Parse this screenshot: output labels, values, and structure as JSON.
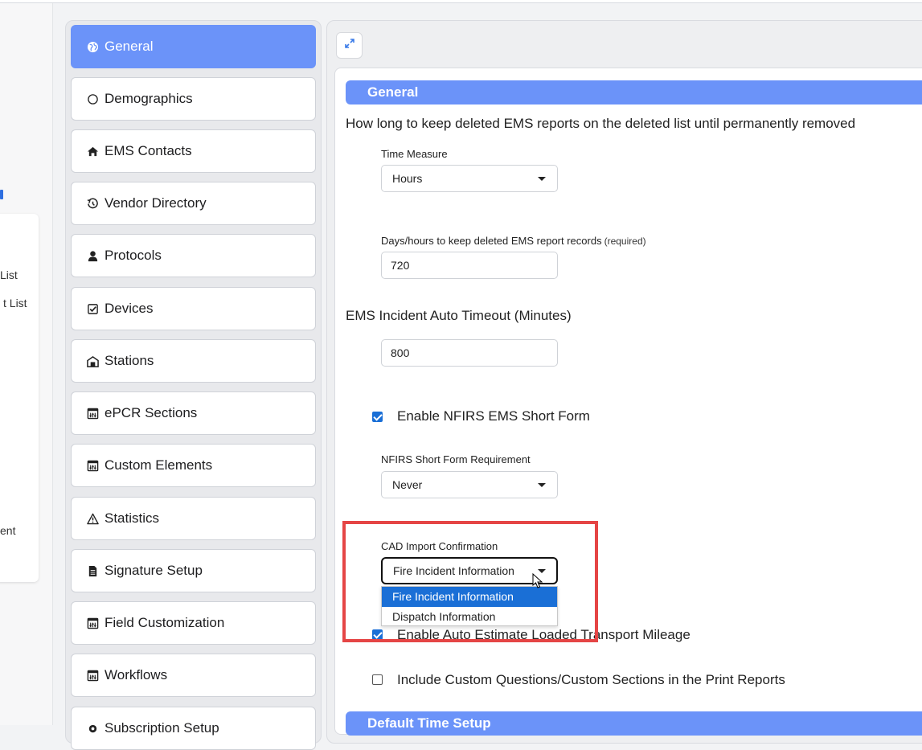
{
  "left_partial": {
    "items": [
      "List",
      "t List",
      "ent"
    ]
  },
  "nav": {
    "items": [
      {
        "label": "General",
        "icon": "globe-icon",
        "active": true
      },
      {
        "label": "Demographics",
        "icon": "circle-icon"
      },
      {
        "label": "EMS Contacts",
        "icon": "home-icon"
      },
      {
        "label": "Vendor Directory",
        "icon": "history-icon"
      },
      {
        "label": "Protocols",
        "icon": "user-icon"
      },
      {
        "label": "Devices",
        "icon": "check-square-icon"
      },
      {
        "label": "Stations",
        "icon": "station-icon"
      },
      {
        "label": "ePCR Sections",
        "icon": "sliders-window-icon"
      },
      {
        "label": "Custom Elements",
        "icon": "sliders-window-icon"
      },
      {
        "label": "Statistics",
        "icon": "warning-icon"
      },
      {
        "label": "Signature Setup",
        "icon": "document-icon"
      },
      {
        "label": "Field Customization",
        "icon": "sliders-window-icon"
      },
      {
        "label": "Workflows",
        "icon": "sliders-window-icon"
      },
      {
        "label": "Subscription Setup",
        "icon": "gear-icon"
      }
    ]
  },
  "main": {
    "expand_icon": "expand-icon",
    "section_general": "General",
    "deleted_question": "How long to keep deleted EMS reports on the deleted list until permanently removed",
    "time_measure": {
      "label": "Time Measure",
      "value": "Hours"
    },
    "days_hours": {
      "label": "Days/hours to keep deleted EMS report records",
      "required": "(required)",
      "value": "720"
    },
    "auto_timeout": {
      "label": "EMS Incident Auto Timeout (Minutes)",
      "value": "800"
    },
    "nfirs_short_form": {
      "label": "Enable NFIRS EMS Short Form",
      "checked": true
    },
    "nfirs_requirement": {
      "label": "NFIRS Short Form Requirement",
      "value": "Never"
    },
    "cad_import": {
      "label": "CAD Import Confirmation",
      "value": "Fire Incident Information",
      "options": [
        "Fire Incident Information",
        "Dispatch Information"
      ]
    },
    "auto_estimate": {
      "label": "Enable Auto Estimate Loaded Transport Mileage",
      "checked": true
    },
    "custom_questions": {
      "label": "Include Custom Questions/Custom Sections in the Print Reports",
      "checked": false
    },
    "section_default_time": "Default Time Setup"
  },
  "colors": {
    "accent": "#6b93f9",
    "highlight": "#e54545",
    "checkbox": "#1a6fd6"
  }
}
